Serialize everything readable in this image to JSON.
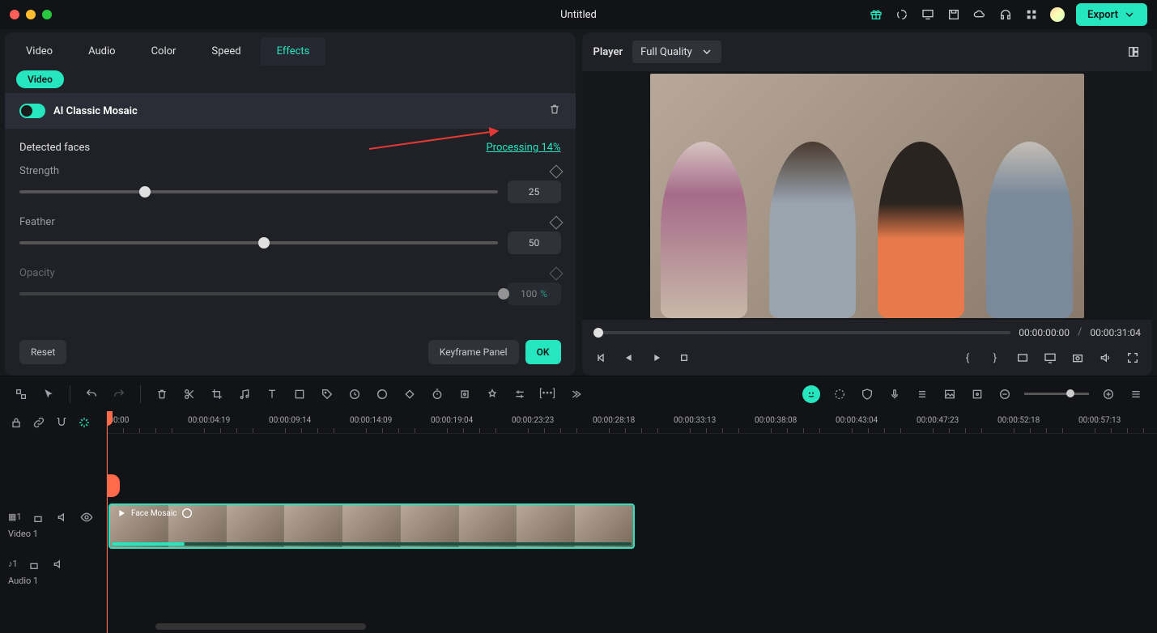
{
  "titlebar": {
    "title": "Untitled",
    "export": "Export"
  },
  "tabs": [
    "Video",
    "Audio",
    "Color",
    "Speed",
    "Effects"
  ],
  "active_tab_index": 4,
  "subtab": "Video",
  "effect": {
    "name": "AI Classic Mosaic",
    "detected_label": "Detected faces",
    "processing": "Processing 14%",
    "params": [
      {
        "label": "Strength",
        "value": "25",
        "pct": 25
      },
      {
        "label": "Feather",
        "value": "50",
        "pct": 50
      },
      {
        "label": "Opacity",
        "value": "100",
        "pct": 100,
        "suffix": "%"
      }
    ]
  },
  "actions": {
    "reset": "Reset",
    "keyframe": "Keyframe Panel",
    "ok": "OK"
  },
  "player": {
    "label": "Player",
    "quality": "Full Quality",
    "current": "00:00:00:00",
    "sep": "/",
    "total": "00:00:31:04"
  },
  "timeline": {
    "ruler": [
      ":00:00",
      "00:00:04:19",
      "00:00:09:14",
      "00:00:14:09",
      "00:00:19:04",
      "00:00:23:23",
      "00:00:28:18",
      "00:00:33:13",
      "00:00:38:08",
      "00:00:43:04",
      "00:00:47:23",
      "00:00:52:18",
      "00:00:57:13"
    ],
    "video_track": "Video 1",
    "audio_track": "Audio 1",
    "clip_label": "Face Mosaic"
  }
}
